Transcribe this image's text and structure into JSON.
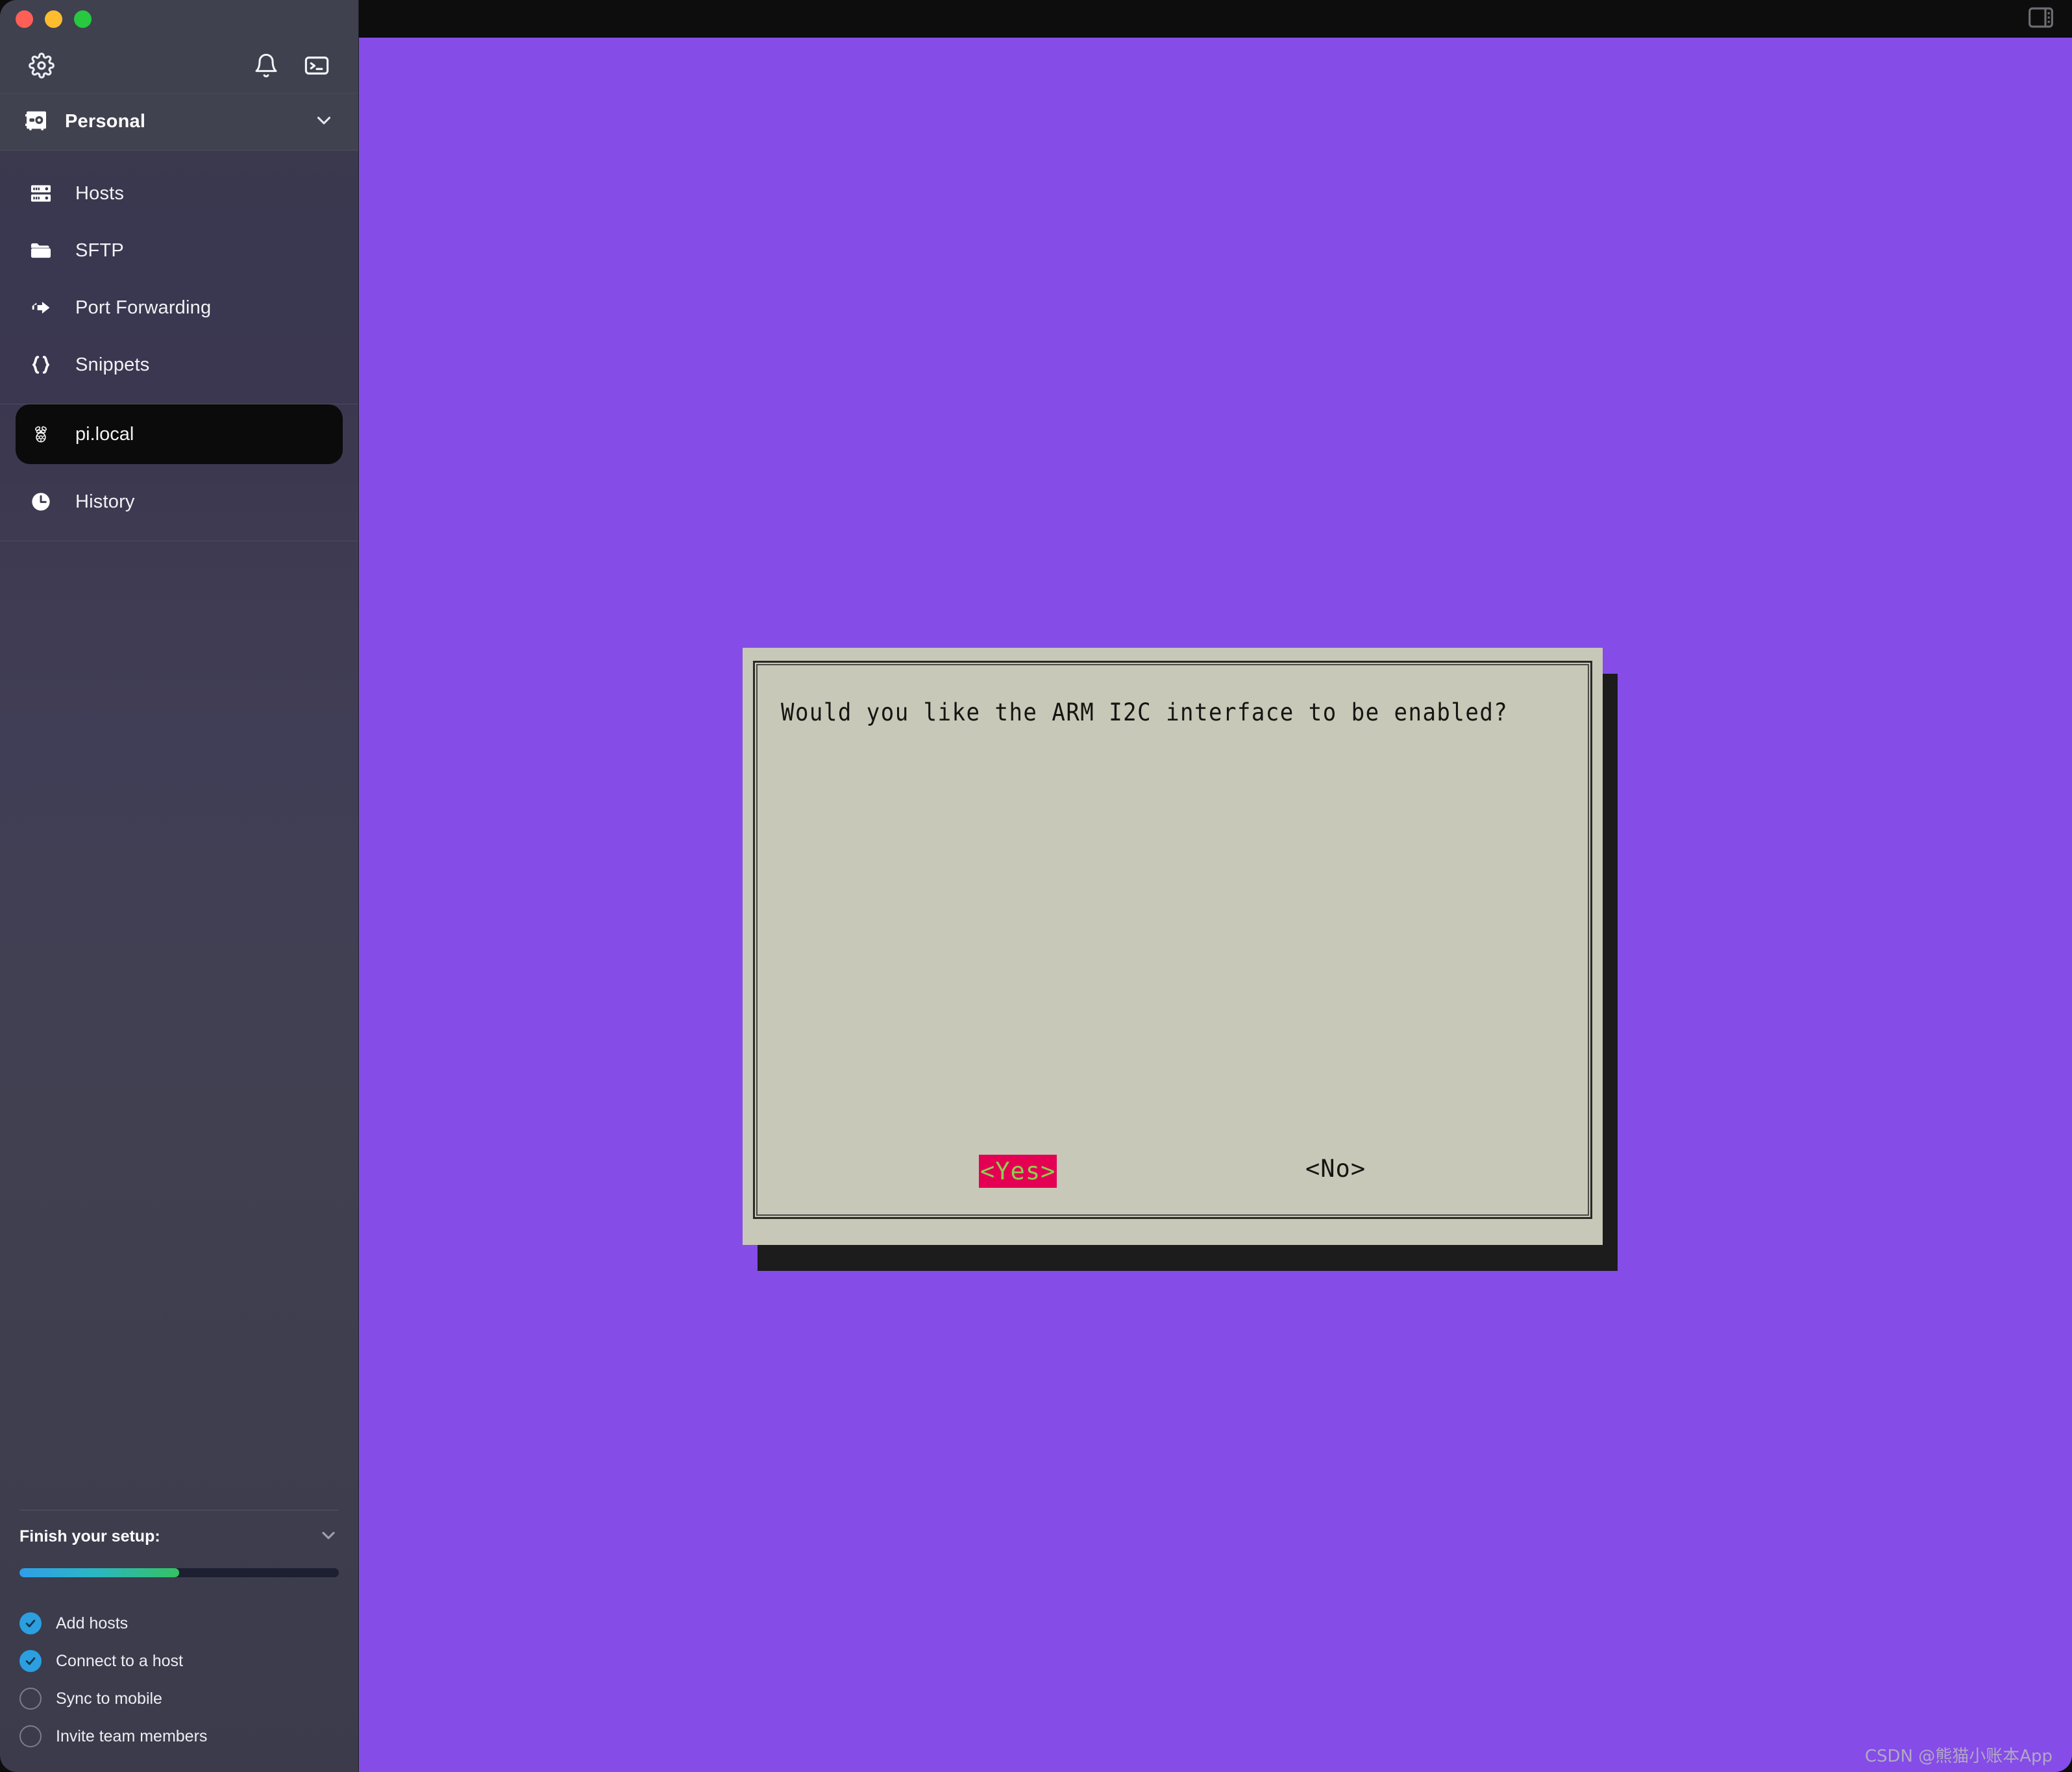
{
  "window": {
    "traffic_lights": [
      {
        "name": "close",
        "color": "#ff5f57"
      },
      {
        "name": "minimize",
        "color": "#febc2e"
      },
      {
        "name": "maximize",
        "color": "#28c840"
      }
    ]
  },
  "toolbar": {
    "settings_icon": "gear-icon",
    "notifications_icon": "bell-icon",
    "terminal_icon": "terminal-icon"
  },
  "vault": {
    "icon": "vault-icon",
    "name": "Personal",
    "chevron": "chevron-down-icon"
  },
  "nav": {
    "items": [
      {
        "label": "Hosts",
        "icon": "server-rack-icon"
      },
      {
        "label": "SFTP",
        "icon": "folder-icon"
      },
      {
        "label": "Port Forwarding",
        "icon": "arrow-forward-icon"
      },
      {
        "label": "Snippets",
        "icon": "braces-icon"
      }
    ],
    "active_host": {
      "label": "pi.local",
      "icon": "raspberry-pi-icon"
    },
    "history": {
      "label": "History",
      "icon": "clock-icon"
    }
  },
  "setup": {
    "title": "Finish your setup:",
    "chevron": "chevron-down-icon",
    "progress_percent": 50,
    "progress_start_color": "#2f9fe8",
    "progress_end_color": "#34c262",
    "tasks": [
      {
        "label": "Add hosts",
        "done": true
      },
      {
        "label": "Connect to a host",
        "done": true
      },
      {
        "label": "Sync to mobile",
        "done": false
      },
      {
        "label": "Invite team members",
        "done": false
      }
    ]
  },
  "terminal": {
    "panel_toggle_icon": "panel-toggle-icon",
    "background_color": "#854ce8",
    "dialog": {
      "message": "Would you like the ARM I2C interface to be enabled?",
      "background_color": "#c7c8b7",
      "buttons": [
        {
          "label": "<Yes>",
          "selected": true,
          "bg": "#e40053",
          "fg": "#8ccf4f"
        },
        {
          "label": "<No>",
          "selected": false,
          "bg": "transparent",
          "fg": "#151513"
        }
      ]
    }
  },
  "watermark": {
    "text": "CSDN @熊猫小账本App"
  }
}
